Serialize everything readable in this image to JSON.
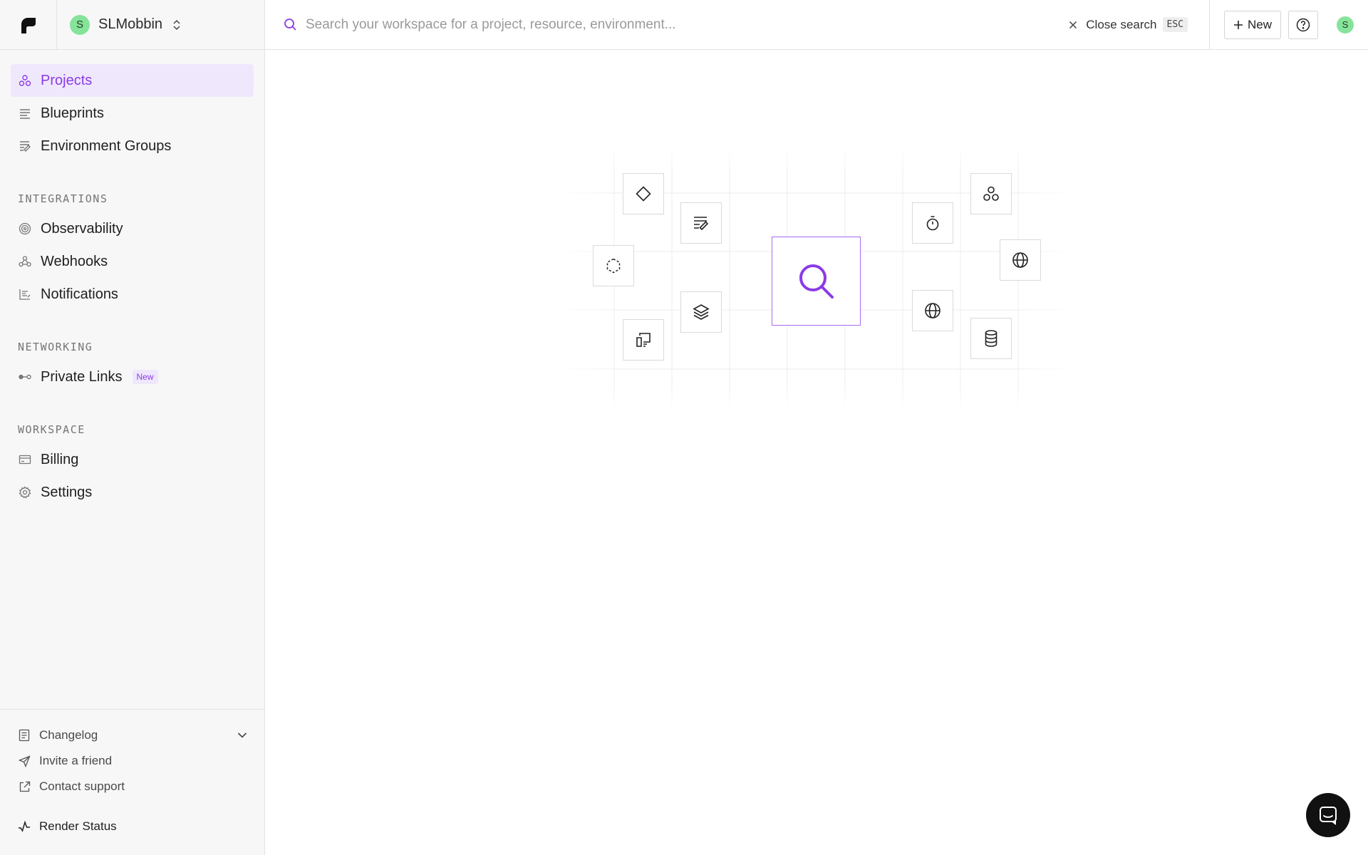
{
  "workspace": {
    "avatar_letter": "S",
    "name": "SLMobbin"
  },
  "sidebar": {
    "main_items": [
      {
        "label": "Projects",
        "icon": "projects-icon",
        "active": true
      },
      {
        "label": "Blueprints",
        "icon": "blueprints-icon"
      },
      {
        "label": "Environment Groups",
        "icon": "environment-groups-icon"
      }
    ],
    "integrations": {
      "heading": "INTEGRATIONS",
      "items": [
        {
          "label": "Observability",
          "icon": "observability-icon"
        },
        {
          "label": "Webhooks",
          "icon": "webhooks-icon"
        },
        {
          "label": "Notifications",
          "icon": "notifications-icon"
        }
      ]
    },
    "networking": {
      "heading": "NETWORKING",
      "items": [
        {
          "label": "Private Links",
          "icon": "private-links-icon",
          "badge": "New"
        }
      ]
    },
    "workspace_section": {
      "heading": "WORKSPACE",
      "items": [
        {
          "label": "Billing",
          "icon": "billing-icon"
        },
        {
          "label": "Settings",
          "icon": "gear-icon"
        }
      ]
    },
    "footer": {
      "changelog": "Changelog",
      "invite": "Invite a friend",
      "support": "Contact support",
      "status": "Render Status"
    }
  },
  "search": {
    "placeholder": "Search your workspace for a project, resource, environment...",
    "close_label": "Close search",
    "close_key": "ESC"
  },
  "toolbar": {
    "new_label": "New",
    "user_avatar_letter": "S"
  },
  "colors": {
    "accent": "#8b3be6",
    "accent_bg": "#efe8fd",
    "avatar_green": "#86e39a"
  }
}
